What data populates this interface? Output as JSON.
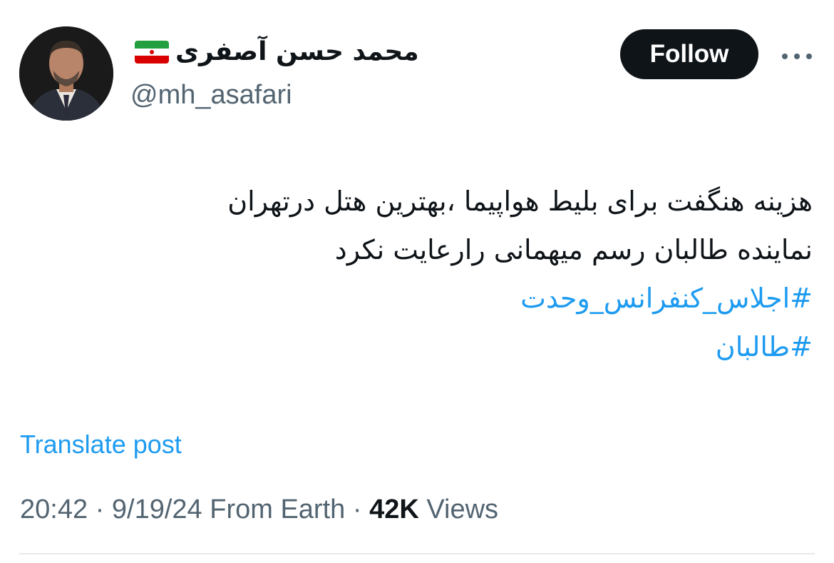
{
  "author": {
    "display_name": "محمد حسن آصفری",
    "handle": "@mh_asafari",
    "flag_icon": "iran-flag-icon"
  },
  "follow_button": {
    "label": "Follow"
  },
  "more_options_icon": "ellipsis-icon",
  "tweet": {
    "lines": [
      "هزینه  هنگفت برای  بلیط هواپیما ،بهترین هتل درتهران",
      "نماینده  طالبان  رسم میهمانی رارعایت نکرد"
    ],
    "hashtags": [
      "#اجلاس_کنفرانس_وحدت",
      "#طالبان"
    ]
  },
  "translate": {
    "label": "Translate post"
  },
  "meta": {
    "time": "20:42",
    "separator": " · ",
    "date": "9/19/24",
    "source": "From Earth",
    "views_count": "42K",
    "views_label": "Views"
  },
  "colors": {
    "accent": "#1d9bf0",
    "text": "#0f1419",
    "secondary": "#536471",
    "button_bg": "#0f1419",
    "divider": "#e7e9ea"
  }
}
